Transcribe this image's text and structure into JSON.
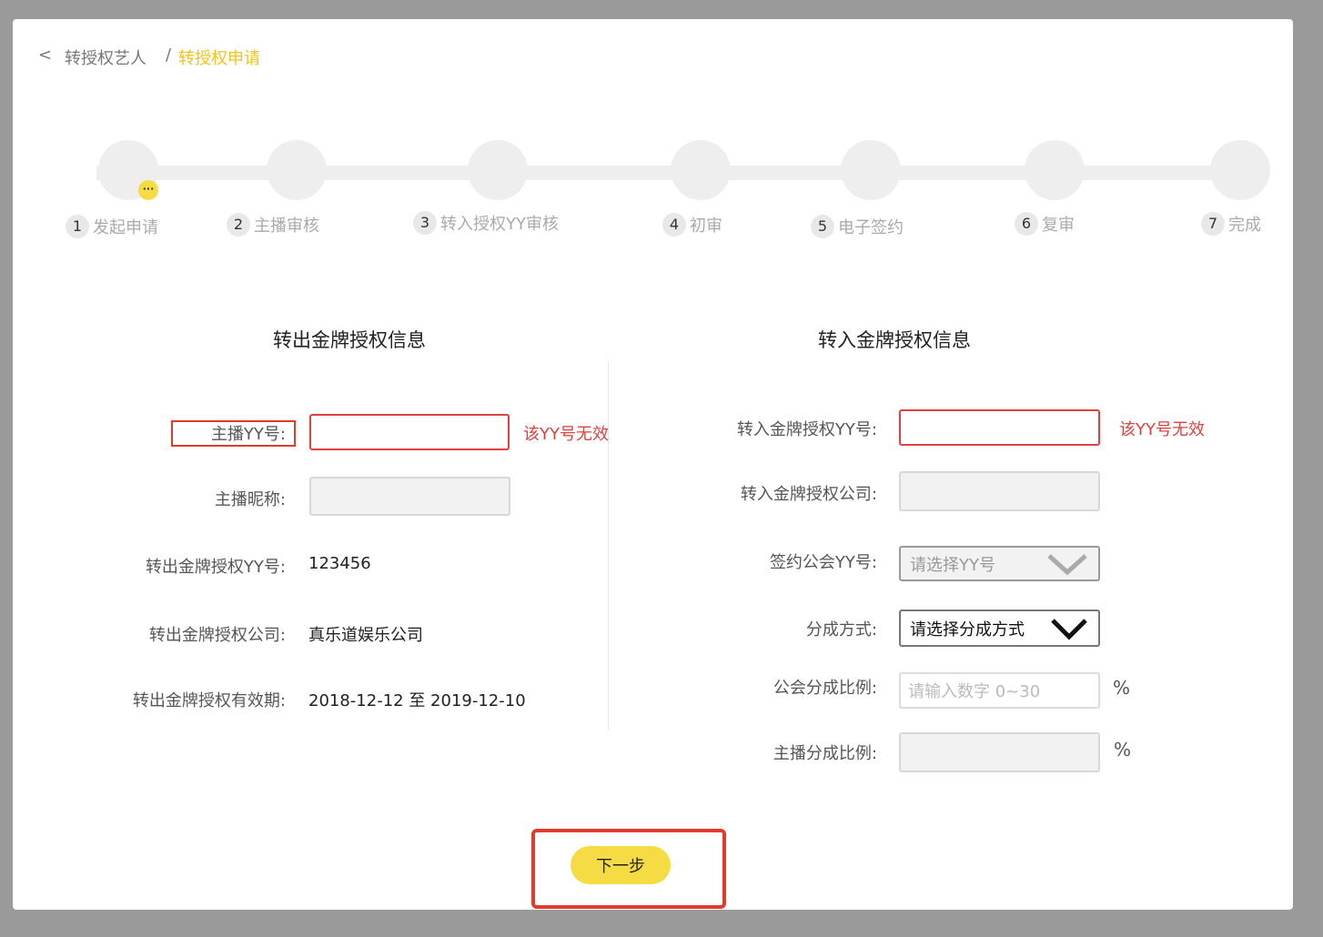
{
  "breadcrumb": {
    "back": "<",
    "parent": "转授权艺人",
    "separator": "/",
    "current": "转授权申请"
  },
  "steps": [
    {
      "num": "1",
      "label": "发起申请"
    },
    {
      "num": "2",
      "label": "主播审核"
    },
    {
      "num": "3",
      "label": "转入授权YY审核"
    },
    {
      "num": "4",
      "label": "初审"
    },
    {
      "num": "5",
      "label": "电子签约"
    },
    {
      "num": "6",
      "label": "复审"
    },
    {
      "num": "7",
      "label": "完成"
    }
  ],
  "pending_indicator": "···",
  "left": {
    "title": "转出金牌授权信息",
    "anchor_yy_label": "主播YY号:",
    "anchor_yy_error": "该YY号无效",
    "nickname_label": "主播昵称:",
    "out_yy_label": "转出金牌授权YY号:",
    "out_yy_value": "123456",
    "out_company_label": "转出金牌授权公司:",
    "out_company_value": "真乐道娱乐公司",
    "validity_label": "转出金牌授权有效期:",
    "validity_value": "2018-12-12 至 2019-12-10"
  },
  "right": {
    "title": "转入金牌授权信息",
    "in_yy_label": "转入金牌授权YY号:",
    "in_yy_error": "该YY号无效",
    "in_company_label": "转入金牌授权公司:",
    "guild_yy_label": "签约公会YY号:",
    "guild_yy_placeholder": "请选择YY号",
    "split_method_label": "分成方式:",
    "split_method_value": "请选择分成方式",
    "guild_ratio_label": "公会分成比例:",
    "guild_ratio_placeholder": "请输入数字 0~30",
    "guild_ratio_unit": "%",
    "anchor_ratio_label": "主播分成比例:",
    "anchor_ratio_unit": "%"
  },
  "next_button": "下一步"
}
